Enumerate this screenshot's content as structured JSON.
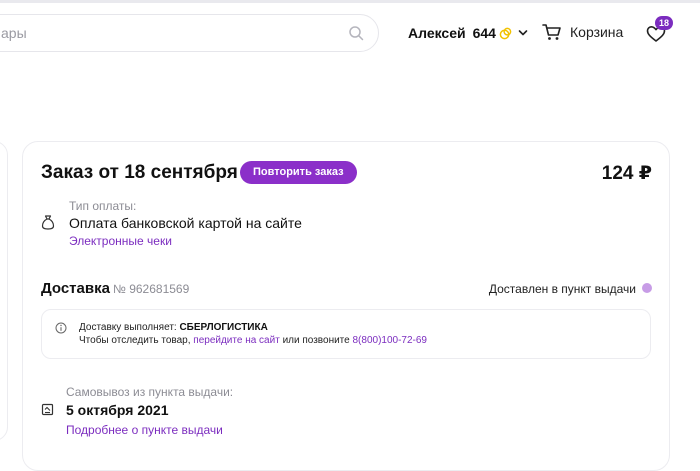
{
  "header": {
    "search_placeholder": "ары",
    "user_name": "Алексей",
    "bonus": "644",
    "cart_label": "Корзина",
    "favorites_count": "18"
  },
  "order": {
    "title": "Заказ от 18 сентября",
    "repeat_label": "Повторить заказ",
    "total": "124 ₽",
    "payment": {
      "label": "Тип оплаты:",
      "method": "Оплата банковской картой на сайте",
      "receipts_link": "Электронные чеки"
    },
    "delivery": {
      "title": "Доставка",
      "number": "№ 962681569",
      "status": "Доставлен в пункт выдачи",
      "info_prefix": "Доставку выполняет: ",
      "carrier": "СБЕРЛОГИСТИКА",
      "track_prefix": "Чтобы отследить товар, ",
      "track_link": "перейдите на сайт",
      "track_middle": " или позвоните ",
      "phone": "8(800)100-72-69"
    },
    "pickup": {
      "label": "Самовывоз из пункта выдачи:",
      "date": "5 октября 2021",
      "more_link": "Подробнее о пункте выдачи"
    }
  },
  "colors": {
    "accent": "#8b2fc9",
    "link": "#7b2cbf",
    "status_dot": "#c79ce6",
    "coin": "#f2c200"
  }
}
